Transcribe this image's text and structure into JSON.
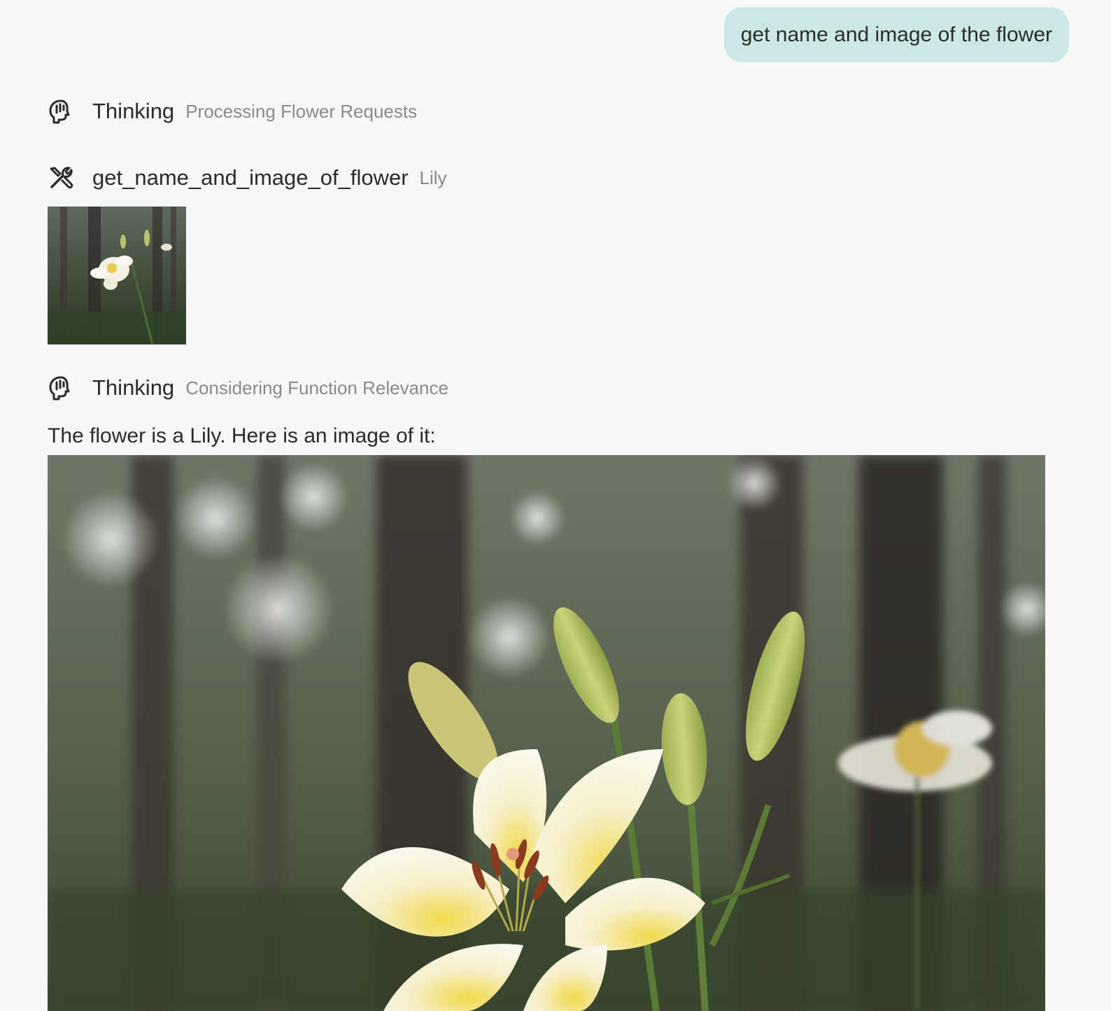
{
  "conversation": {
    "user_message": "get name and image of the flower",
    "steps": [
      {
        "type": "thinking",
        "title": "Thinking",
        "subtitle": "Processing Flower Requests",
        "icon": "brain-head-icon"
      },
      {
        "type": "tool",
        "title": "get_name_and_image_of_flower",
        "subtitle": "Lily",
        "icon": "tools-icon"
      },
      {
        "type": "thinking",
        "title": "Thinking",
        "subtitle": "Considering Function Relevance",
        "icon": "brain-head-icon"
      }
    ],
    "answer": "The flower is a Lily. Here is an image of it:"
  },
  "colors": {
    "background": "#f6f8f7",
    "user_bubble": "#cce8e6",
    "muted_text": "#8a8a8a"
  }
}
